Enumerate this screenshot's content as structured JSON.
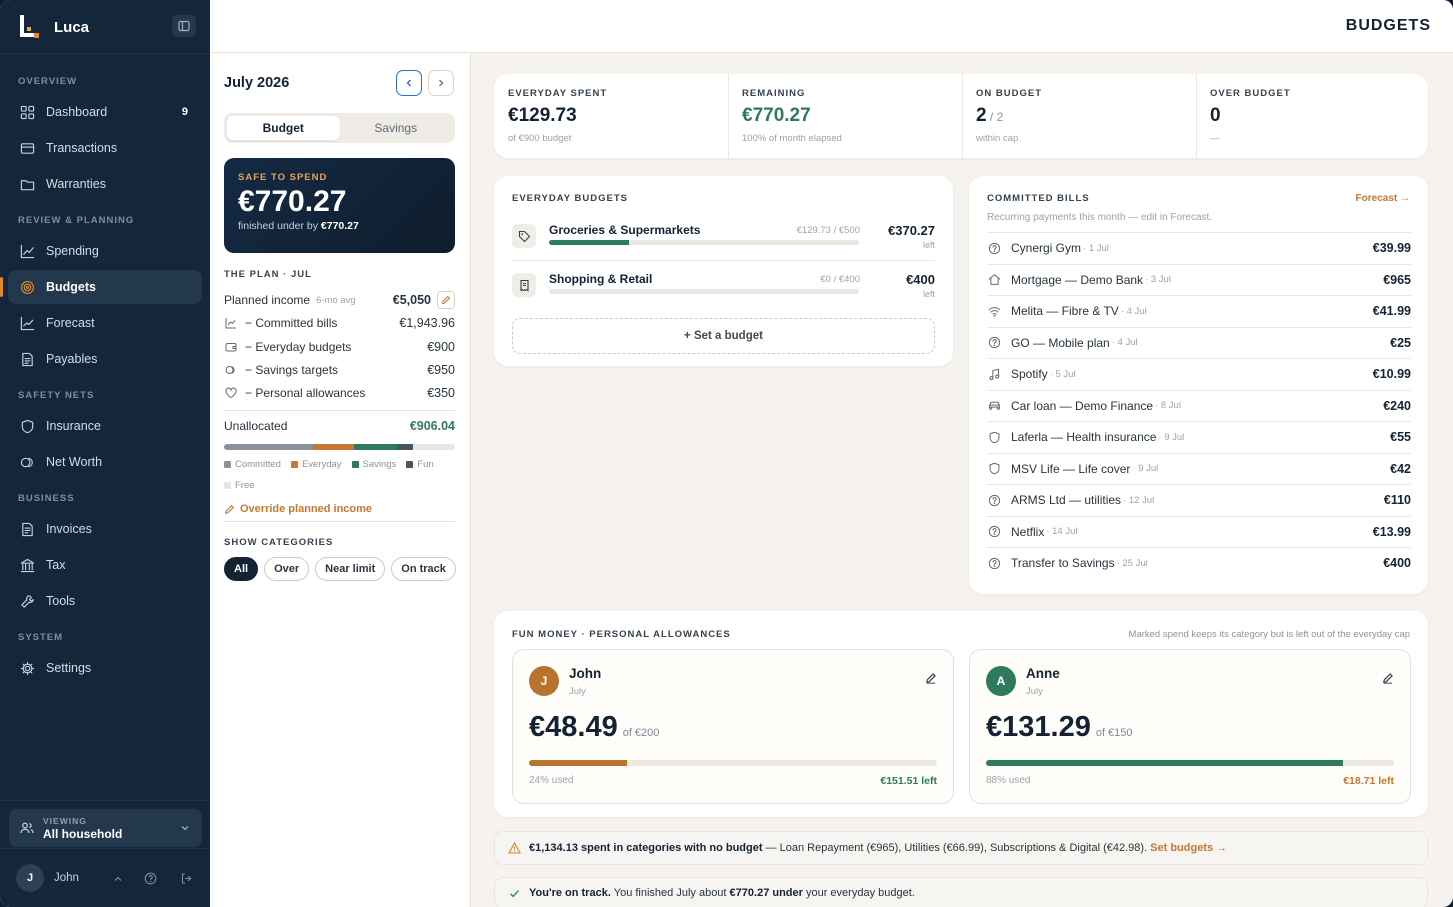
{
  "app": {
    "name": "Luca",
    "page_title": "BUDGETS"
  },
  "sidebar": {
    "sections": [
      {
        "label": "OVERVIEW",
        "items": [
          {
            "label": "Dashboard",
            "icon": "grid-icon",
            "badge": "9"
          },
          {
            "label": "Transactions",
            "icon": "card-icon"
          },
          {
            "label": "Warranties",
            "icon": "folder-icon"
          }
        ]
      },
      {
        "label": "REVIEW & PLANNING",
        "items": [
          {
            "label": "Spending",
            "icon": "chart-line-icon"
          },
          {
            "label": "Budgets",
            "icon": "target-icon",
            "active": true
          },
          {
            "label": "Forecast",
            "icon": "trend-icon"
          },
          {
            "label": "Payables",
            "icon": "document-icon"
          }
        ]
      },
      {
        "label": "SAFETY NETS",
        "items": [
          {
            "label": "Insurance",
            "icon": "shield-icon"
          },
          {
            "label": "Net Worth",
            "icon": "coins-icon"
          }
        ]
      },
      {
        "label": "BUSINESS",
        "items": [
          {
            "label": "Invoices",
            "icon": "invoice-icon"
          },
          {
            "label": "Tax",
            "icon": "bank-icon"
          },
          {
            "label": "Tools",
            "icon": "wrench-icon"
          }
        ]
      },
      {
        "label": "SYSTEM",
        "items": [
          {
            "label": "Settings",
            "icon": "gear-icon"
          }
        ]
      }
    ],
    "viewing_label": "VIEWING",
    "viewing_value": "All household",
    "user_initial": "J",
    "user_name": "John"
  },
  "left_panel": {
    "month": "July 2026",
    "tabs": [
      "Budget",
      "Savings"
    ],
    "safe": {
      "label": "SAFE TO SPEND",
      "value": "€770.27",
      "sub_prefix": "finished under by",
      "sub_value": "€770.27"
    },
    "plan_heading": "THE PLAN · JUL",
    "planned_income": {
      "label": "Planned income",
      "note": "6-mo avg",
      "value": "€5,050"
    },
    "rows": [
      {
        "label": "− Committed bills",
        "value": "€1,943.96"
      },
      {
        "label": "− Everyday budgets",
        "value": "€900"
      },
      {
        "label": "− Savings targets",
        "value": "€950"
      },
      {
        "label": "− Personal allowances",
        "value": "€350"
      }
    ],
    "unallocated": {
      "label": "Unallocated",
      "value": "€906.04"
    },
    "allocation": [
      {
        "name": "Committed",
        "fraction": 0.385,
        "color": "#8a939c"
      },
      {
        "name": "Everyday",
        "fraction": 0.178,
        "color": "#c47830"
      },
      {
        "name": "Savings",
        "fraction": 0.188,
        "color": "#2f7a5e"
      },
      {
        "name": "Fun",
        "fraction": 0.069,
        "color": "#4a5560"
      },
      {
        "name": "Free",
        "fraction": 0.18,
        "color": "#e8e6e1"
      }
    ],
    "override_label": "Override planned income",
    "show_heading": "SHOW CATEGORIES",
    "filters": [
      "All",
      "Over",
      "Near limit",
      "On track"
    ]
  },
  "kpis": [
    {
      "label": "EVERYDAY SPENT",
      "value": "€129.73",
      "value_suffix": "",
      "sub": "of €900 budget",
      "color": "#142233"
    },
    {
      "label": "REMAINING",
      "value": "€770.27",
      "value_suffix": "",
      "sub": "100% of month elapsed",
      "color": "#2f7a5e"
    },
    {
      "label": "ON BUDGET",
      "value": "2",
      "value_suffix": " / 2",
      "sub": "within cap",
      "color": "#142233"
    },
    {
      "label": "OVER BUDGET",
      "value": "0",
      "value_suffix": "",
      "sub": "—",
      "color": "#142233"
    }
  ],
  "everyday": {
    "heading": "EVERYDAY BUDGETS",
    "items": [
      {
        "name": "Groceries & Supermarkets",
        "ratio": "€129.73 / €500",
        "amount": "€370.27",
        "left": "left",
        "progress": 0.259,
        "icon": "tag-icon"
      },
      {
        "name": "Shopping & Retail",
        "ratio": "€0 / €400",
        "amount": "€400",
        "left": "left",
        "progress": 0,
        "icon": "receipt-icon"
      }
    ],
    "set_budget": "+ Set a budget"
  },
  "bills": {
    "heading": "COMMITTED BILLS",
    "link": "Forecast →",
    "subtitle": "Recurring payments this month — edit in Forecast.",
    "items": [
      {
        "name": "Cynergi Gym",
        "date": "· 1 Jul",
        "amount": "€39.99",
        "icon": "help-circle-icon"
      },
      {
        "name": "Mortgage — Demo Bank",
        "date": "· 3 Jul",
        "amount": "€965",
        "icon": "home-icon"
      },
      {
        "name": "Melita — Fibre & TV",
        "date": "· 4 Jul",
        "amount": "€41.99",
        "icon": "wifi-icon"
      },
      {
        "name": "GO — Mobile plan",
        "date": "· 4 Jul",
        "amount": "€25",
        "icon": "help-circle-icon"
      },
      {
        "name": "Spotify",
        "date": "· 5 Jul",
        "amount": "€10.99",
        "icon": "music-icon"
      },
      {
        "name": "Car loan — Demo Finance",
        "date": "· 8 Jul",
        "amount": "€240",
        "icon": "car-icon"
      },
      {
        "name": "Laferla — Health insurance",
        "date": "· 9 Jul",
        "amount": "€55",
        "icon": "shield-icon"
      },
      {
        "name": "MSV Life — Life cover",
        "date": "· 9 Jul",
        "amount": "€42",
        "icon": "shield-icon"
      },
      {
        "name": "ARMS Ltd — utilities",
        "date": "· 12 Jul",
        "amount": "€110",
        "icon": "help-circle-icon"
      },
      {
        "name": "Netflix",
        "date": "· 14 Jul",
        "amount": "€13.99",
        "icon": "help-circle-icon"
      },
      {
        "name": "Transfer to Savings",
        "date": "· 25 Jul",
        "amount": "€400",
        "icon": "help-circle-icon"
      }
    ]
  },
  "fun": {
    "heading": "FUN MONEY · PERSONAL ALLOWANCES",
    "note": "Marked spend keeps its category but is left out of the everyday cap",
    "people": [
      {
        "initial": "J",
        "name": "John",
        "month": "July",
        "spent": "€48.49",
        "of": "of €200",
        "used": "24% used",
        "left": "€151.51 left",
        "progress": 0.24,
        "color": "#b8742e",
        "left_color": "#2f7a5e"
      },
      {
        "initial": "A",
        "name": "Anne",
        "month": "July",
        "spent": "€131.29",
        "of": "of €150",
        "used": "88% used",
        "left": "€18.71 left",
        "progress": 0.875,
        "color": "#2f7a5e",
        "left_color": "#c47830"
      }
    ]
  },
  "banners": {
    "warning": {
      "bold": "€1,134.13 spent in categories with no budget",
      "text": " — Loan Repayment (€965), Utilities (€66.99), Subscriptions & Digital (€42.98). ",
      "link": "Set budgets →"
    },
    "ok": {
      "bold1": "You're on track.",
      "text1": " You finished July about ",
      "bold2": "€770.27 under",
      "text2": " your everyday budget."
    }
  }
}
